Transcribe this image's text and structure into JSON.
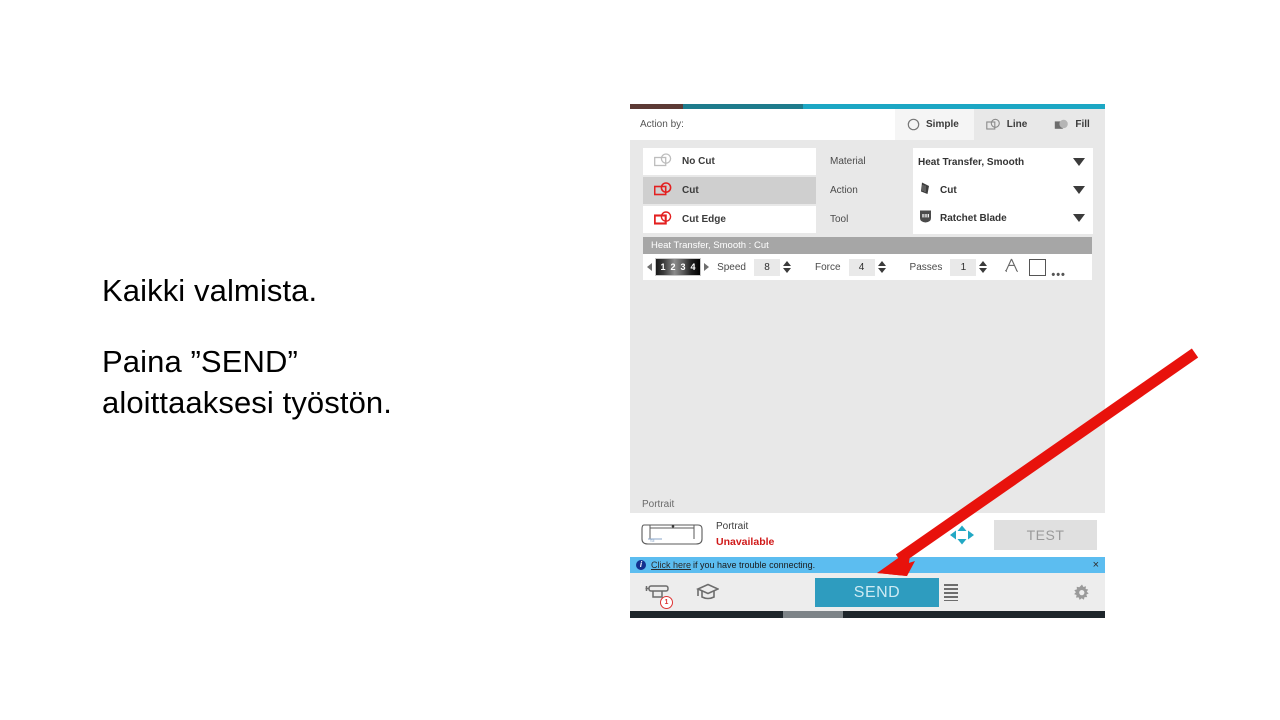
{
  "slide": {
    "line1": "Kaikki valmista.",
    "line2": "Paina ”SEND”",
    "line3": "aloittaaksesi työstön."
  },
  "panel": {
    "header": {
      "action_by_label": "Action by:",
      "tabs": [
        {
          "label": "Simple",
          "icon": "circle-outline-icon",
          "active": true
        },
        {
          "label": "Line",
          "icon": "line-shapes-icon",
          "active": false
        },
        {
          "label": "Fill",
          "icon": "fill-shapes-icon",
          "active": false
        }
      ]
    },
    "action_list": [
      {
        "label": "No Cut",
        "icon": "no-cut-icon",
        "selected": false
      },
      {
        "label": "Cut",
        "icon": "cut-icon",
        "selected": true
      },
      {
        "label": "Cut Edge",
        "icon": "cut-edge-icon",
        "selected": false
      }
    ],
    "settings": {
      "labels": {
        "material": "Material",
        "action": "Action",
        "tool": "Tool"
      },
      "material_value": "Heat Transfer, Smooth",
      "action_value": "Cut",
      "tool_value": "Ratchet Blade",
      "action_icon": "blade-tip-icon",
      "tool_icon": "ratchet-blade-icon",
      "caret": "chevron-down-icon"
    },
    "preset_title": "Heat Transfer, Smooth : Cut",
    "params": {
      "blade_gauge": [
        "1",
        "2",
        "3",
        "4"
      ],
      "speed_label": "Speed",
      "speed_value": "8",
      "force_label": "Force",
      "force_value": "4",
      "passes_label": "Passes",
      "passes_value": "1",
      "extra_icons": [
        "compass-triangle-icon",
        "square-outline-icon",
        "more-dots-icon"
      ]
    },
    "machine": {
      "section_label": "Portrait",
      "name": "Portrait",
      "status": "Unavailable",
      "status_color": "#d01919",
      "test_label": "TEST",
      "dpad_icon": "dpad-arrows-icon",
      "machine_icon": "cutting-machine-icon"
    },
    "info_bar": {
      "icon": "info-icon",
      "link_text": "Click here",
      "message": " if you have trouble connecting.",
      "close": "×",
      "background": "#5cbdf0"
    },
    "footer": {
      "cutter_icon": "cutter-queue-icon",
      "cutter_badge": "1",
      "learn_icon": "graduation-cap-icon",
      "send_label": "SEND",
      "send_color": "#2e9cbf",
      "list_icon": "list-lines-icon",
      "settings_icon": "gear-icon"
    }
  },
  "annotation": {
    "arrow": "red-pointer-arrow",
    "color": "#e8120c"
  }
}
